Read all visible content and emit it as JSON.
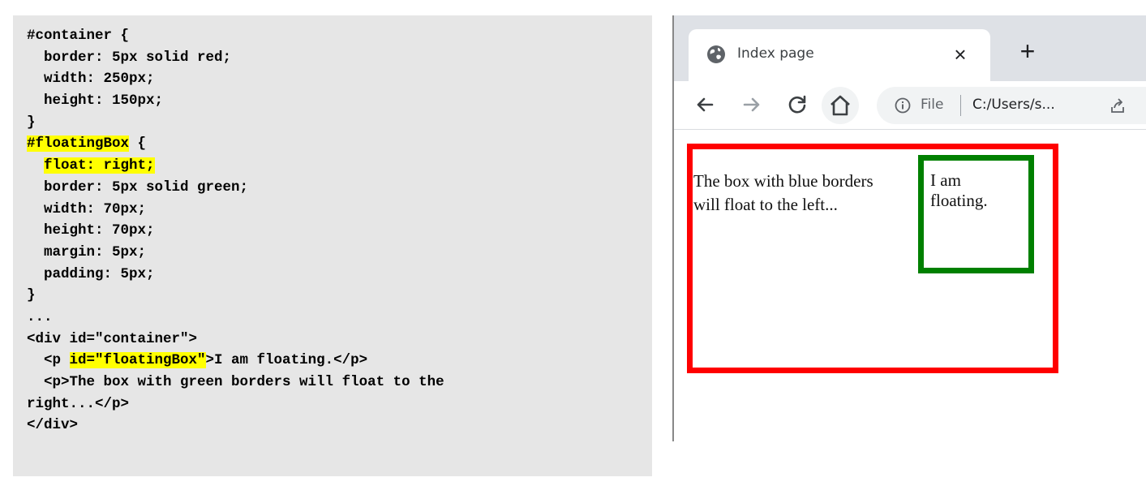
{
  "code": {
    "lines": [
      [
        {
          "t": "#container {"
        }
      ],
      [
        {
          "t": "  border: 5px solid red;"
        }
      ],
      [
        {
          "t": "  width: 250px;"
        }
      ],
      [
        {
          "t": "  height: 150px;"
        }
      ],
      [
        {
          "t": "}"
        }
      ],
      [
        {
          "t": "#floatingBox",
          "hl": true
        },
        {
          "t": " {"
        }
      ],
      [
        {
          "t": "  "
        },
        {
          "t": "float: right;",
          "hl": true
        }
      ],
      [
        {
          "t": "  border: 5px solid green;"
        }
      ],
      [
        {
          "t": "  width: 70px;"
        }
      ],
      [
        {
          "t": "  height: 70px;"
        }
      ],
      [
        {
          "t": "  margin: 5px;"
        }
      ],
      [
        {
          "t": "  padding: 5px;"
        }
      ],
      [
        {
          "t": "}"
        }
      ],
      [
        {
          "t": "..."
        }
      ],
      [
        {
          "t": "<div id=\"container\">"
        }
      ],
      [
        {
          "t": "  <p "
        },
        {
          "t": "id=\"floatingBox\"",
          "hl": true
        },
        {
          "t": ">I am floating.</p>"
        }
      ],
      [
        {
          "t": "  <p>The box with green borders will float to the"
        }
      ],
      [
        {
          "t": "right...</p>"
        }
      ],
      [
        {
          "t": "</div>"
        }
      ]
    ]
  },
  "browser": {
    "tab": {
      "title": "Index page",
      "close_label": "×",
      "icon": "globe-icon"
    },
    "new_tab_label": "+",
    "toolbar": {
      "icons": [
        "back-arrow-icon",
        "forward-arrow-icon",
        "reload-icon",
        "home-icon",
        "info-icon",
        "share-icon"
      ],
      "url_scheme": "File",
      "url": "C:/Users/s..."
    },
    "page": {
      "float_text": "I am\nfloating.",
      "para_text": "The box with blue borders will float to the left...",
      "container_border_color": "#ff0000",
      "float_border_color": "#008000"
    }
  },
  "colors": {
    "code_bg": "#e6e6e6",
    "highlight": "#ffff00",
    "tabstrip_bg": "#dee1e6"
  }
}
